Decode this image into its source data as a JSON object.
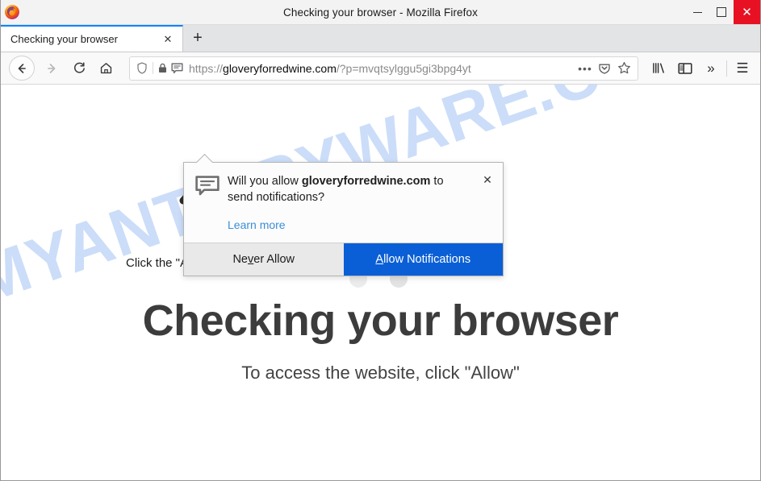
{
  "window": {
    "title": "Checking your browser - Mozilla Firefox",
    "logo_icon": "firefox-logo-icon",
    "minimize_label": "—",
    "maximize_label": "❑",
    "close_label": "✕",
    "accent_close_color": "#e81123"
  },
  "tabstrip": {
    "tabs": [
      {
        "title": "Checking your browser",
        "close_label": "✕",
        "active": true
      }
    ],
    "new_tab_label": "+",
    "active_tab_indicator_color": "#0a84ff"
  },
  "toolbar": {
    "back_label": "←",
    "forward_label": "→",
    "reload_label": "⟳",
    "home_label": "⌂",
    "urlbar": {
      "scheme": "https://",
      "host": "gloveryforredwine.com",
      "path": "/?p=mvqtsylggu5gi3bpg4yt",
      "full_url": "https://gloveryforredwine.com/?p=mvqtsylggu5gi3bpg4yt",
      "page_actions_label": "•••",
      "identity_icon": "shield-icon",
      "lock_icon": "padlock-icon",
      "notification_icon": "speech-bubble-icon",
      "pocket_icon": "pocket-icon",
      "bookmark_icon": "star-icon"
    },
    "library_icon": "library-icon",
    "sidebar_icon": "sidebar-icon",
    "overflow_label": "»",
    "menu_label": "☰"
  },
  "popup": {
    "icon": "speech-bubble-icon",
    "question_prefix": "Will you allow ",
    "question_domain": "gloveryforredwine.com",
    "question_suffix": " to send notifications?",
    "learn_more": "Learn more",
    "close_label": "✕",
    "never_allow_before": "Ne",
    "never_allow_key": "v",
    "never_allow_after": "er Allow",
    "allow_key": "A",
    "allow_after": "llow Notifications",
    "allow_button_color": "#0a5fd6"
  },
  "page": {
    "watermark": "MYANTISPYWARE.COM",
    "watermark_color": "#c9dcf8",
    "arrow_icon": "up-arrow-icon",
    "hint": "Click the \"Allow\" button",
    "headline": "Checking your browser",
    "subline": "To access the website, click \"Allow\"",
    "loader_dots": 2
  }
}
